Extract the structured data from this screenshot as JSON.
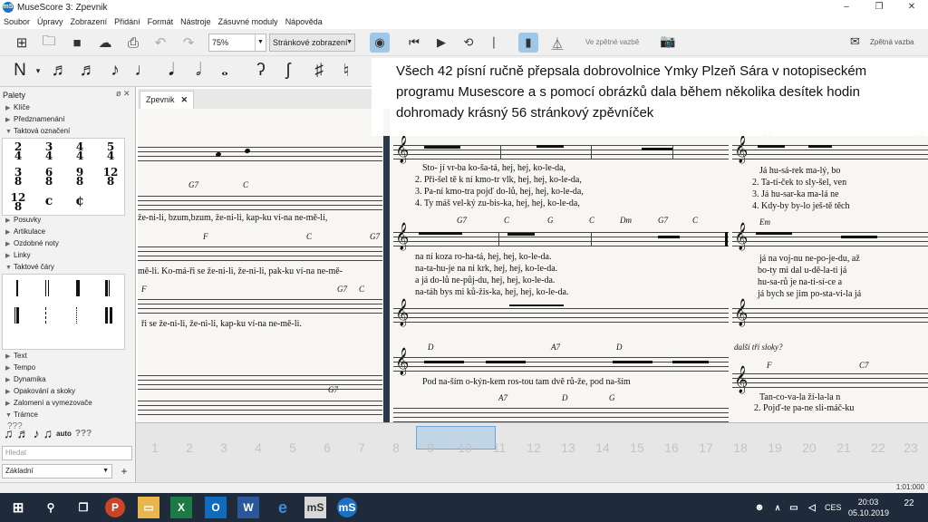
{
  "window": {
    "title": "MuseScore 3: Zpevnik",
    "app_icon": "musescore-icon",
    "controls": [
      "–",
      "❐",
      "✕"
    ]
  },
  "menu": [
    "Soubor",
    "Úpravy",
    "Zobrazení",
    "Přidání",
    "Formát",
    "Nástroje",
    "Zásuvné moduly",
    "Nápověda"
  ],
  "toolbar": {
    "zoom": "75%",
    "view_mode": "Stránkové zobrazení",
    "loop_text": "Ve zpětné vazbě",
    "feedback_text": "Zpětná vazba"
  },
  "palette": {
    "title": "Palety",
    "sections_top": [
      "Klíče",
      "Předznamenání",
      "Taktová označení"
    ],
    "time_signatures": [
      [
        "2",
        "4"
      ],
      [
        "3",
        "4"
      ],
      [
        "4",
        "4"
      ],
      [
        "5",
        "4"
      ],
      [
        "3",
        "8"
      ],
      [
        "6",
        "8"
      ],
      [
        "9",
        "8"
      ],
      [
        "12",
        "8"
      ],
      [
        "12",
        "8"
      ],
      [
        "c",
        ""
      ],
      [
        "¢",
        ""
      ]
    ],
    "sections_mid": [
      "Posuvky",
      "Artikulace",
      "Ozdobné noty",
      "Linky",
      "Taktové čáry"
    ],
    "more": "???",
    "sections_bottom": [
      "Text",
      "Tempo",
      "Dynamika",
      "Opakování a skoky",
      "Zalomení a vymezovače",
      "Trámce"
    ],
    "tools": [
      "auto",
      "???"
    ],
    "search_placeholder": "Hledat",
    "workspace": "Základní"
  },
  "tab": {
    "label": "Zpevnik"
  },
  "caption": {
    "text": "Všech 42 písní ručně přepsala dobrovolnice Ymky Plzeň Sára v notopiseckém programu Musescore a s pomocí obrázků dala během několika desítek hodin dohromady krásný 56 stránkový zpěvníček"
  },
  "left_page": {
    "chords1": [
      "G7",
      "C"
    ],
    "lyric1": "že-ni-li, bzum,bzum, že-ni-li, kap-ku ví-na ne-mě-li,",
    "chords2": [
      "F",
      "C",
      "G7"
    ],
    "lyric2": "mě-li. Ko-má-ři se že-ni-li, že-ni-li, pak-ku ví-na ne-mě-",
    "chords3": [
      "F",
      "G7",
      "C"
    ],
    "lyric3": "ři se že-ni-li, že-ni-li, kap-ku ví-na ne-mě-li.",
    "chords4": [
      "G7"
    ]
  },
  "mid_page": {
    "verses1": [
      "Sto- jí vr-ba ko-ša-tá, hej, hej, ko-le-da,",
      "2. Při-šel tě k ní kmo-tr vlk, hej, hej, ko-le-da,",
      "3. Pa-ní kmo-tra pojď do-lů, hej, hej, ko-le-da,",
      "4. Ty máš vel-ký zu-bis-ka, hej, hej, ko-le-da,"
    ],
    "chords2": [
      "G7",
      "C",
      "G",
      "C",
      "Dm",
      "G7",
      "C"
    ],
    "verses2": [
      "na ní koza ro-ha-tá, hej, hej, ko-le-da.",
      "na-ta-hu-je na ni krk, hej, hej, ko-le-da.",
      "a já do-lů ne-půj-du, hej, hej, ko-le-da.",
      "na-táh bys mi ků-žis-ka, hej, hej, ko-le-da."
    ],
    "chords4": [
      "D",
      "A7",
      "D"
    ],
    "lyric4": "Pod na-ším o-kýn-kem ros-tou tam dvě rů-že, pod na-ším",
    "chords5": [
      "A7",
      "D",
      "G"
    ]
  },
  "right_page": {
    "chords1": [
      "Em",
      "D7"
    ],
    "verses1": [
      "Já hu-sá-rek ma-lý, bo",
      "2. Ta-tí-ček to sly-šel, ven",
      "3. Já hu-sar-ka ma-lá ne",
      "4. Kdy-by by-lo ješ-tě těch"
    ],
    "chords2": [
      "Em"
    ],
    "verses2": [
      "já na voj-nu ne-po-je-du, až",
      "bo-ty mi dal u-dě-la-ti já",
      "hu-sa-rů je na-ti-sí-ce a",
      "já bych se jim po-sta-vi-la já"
    ],
    "note": "další tři sloky?",
    "chords3": [
      "F",
      "C7"
    ],
    "verses3": [
      "Tan-co-va-la ží-la-la n",
      "2. Pojď-te pa-ne sli-máč-ku"
    ]
  },
  "navigator": {
    "pages": [
      "1",
      "2",
      "3",
      "4",
      "5",
      "6",
      "7",
      "8",
      "9",
      "10",
      "11",
      "12",
      "13",
      "14",
      "15",
      "16",
      "17",
      "18",
      "19",
      "20",
      "21",
      "22",
      "23"
    ]
  },
  "statusbar": {
    "time": "1:01:000"
  },
  "taskbar": {
    "time": "20:03",
    "date": "05.10.2019",
    "language": "CES",
    "notifications": "22"
  }
}
